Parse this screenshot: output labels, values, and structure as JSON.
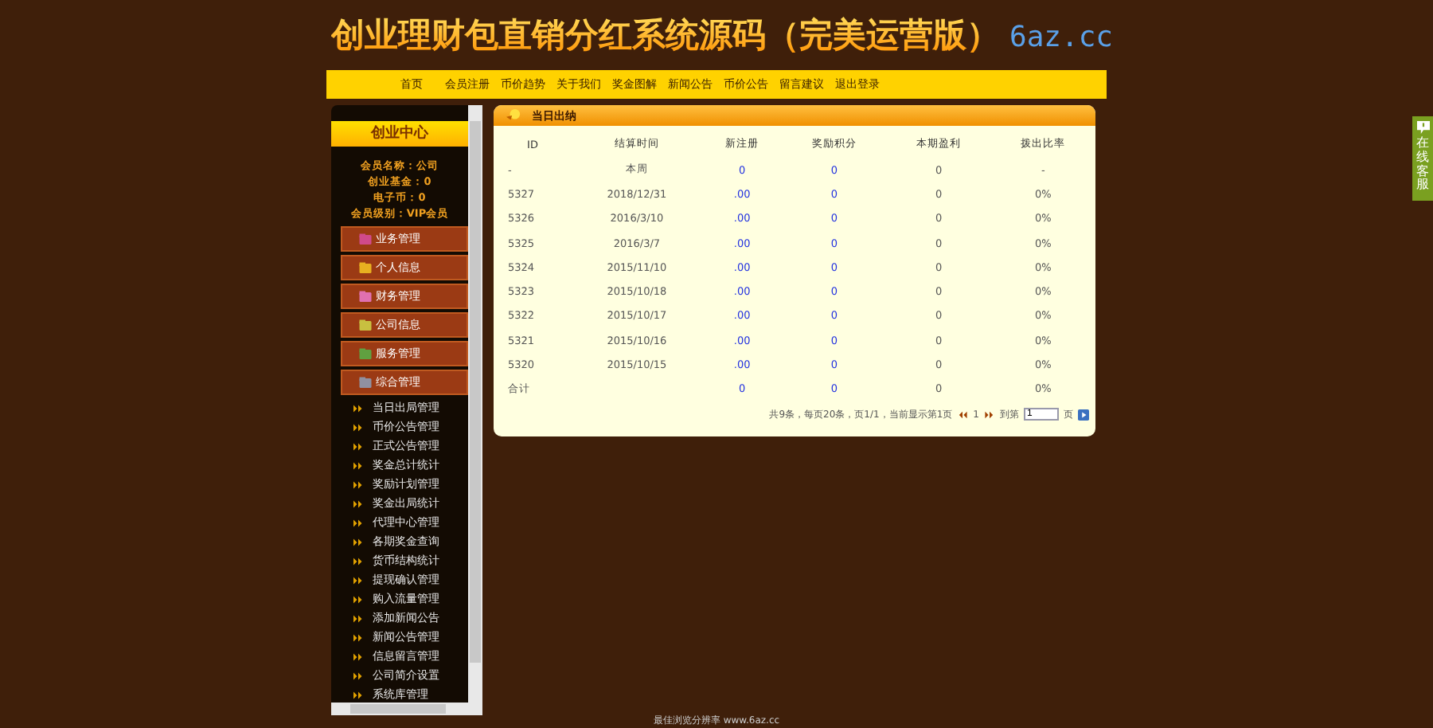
{
  "header": {
    "title": "创业理财包直销分红系统源码（完美运营版）",
    "domain": "6az.cc"
  },
  "nav": [
    "首页",
    "会员注册",
    "币价趋势",
    "关于我们",
    "奖金图解",
    "新闻公告",
    "币价公告",
    "留言建议",
    "退出登录"
  ],
  "sidebar": {
    "title": "创业中心",
    "info": [
      "会员名称：公司",
      "创业基金：0",
      "电子币：0",
      "会员级别：VIP会员"
    ],
    "menu": [
      {
        "label": "业务管理"
      },
      {
        "label": "个人信息"
      },
      {
        "label": "财务管理"
      },
      {
        "label": "公司信息"
      },
      {
        "label": "服务管理"
      },
      {
        "label": "综合管理"
      }
    ],
    "subitems": [
      "当日出局管理",
      "币价公告管理",
      "正式公告管理",
      "奖金总计统计",
      "奖励计划管理",
      "奖金出局统计",
      "代理中心管理",
      "各期奖金查询",
      "货币结构统计",
      "提现确认管理",
      "购入流量管理",
      "添加新闻公告",
      "新闻公告管理",
      "信息留言管理",
      "公司简介设置",
      "系统库管理"
    ]
  },
  "panel": {
    "title": "当日出纳",
    "columns": [
      "ID",
      "结算时间",
      "新注册",
      "奖励积分",
      "本期盈利",
      "拨出比率"
    ],
    "rows": [
      [
        "-",
        "本周",
        "0",
        "0",
        "0",
        "-"
      ],
      [
        "5327",
        "2018/12/31",
        ".00",
        "0",
        "0",
        "0%"
      ],
      [
        "5326",
        "2016/3/10",
        ".00",
        "0",
        "0",
        "0%"
      ],
      [
        "5325",
        "2016/3/7",
        ".00",
        "0",
        "0",
        "0%"
      ],
      [
        "5324",
        "2015/11/10",
        ".00",
        "0",
        "0",
        "0%"
      ],
      [
        "5323",
        "2015/10/18",
        ".00",
        "0",
        "0",
        "0%"
      ],
      [
        "5322",
        "2015/10/17",
        ".00",
        "0",
        "0",
        "0%"
      ],
      [
        "5321",
        "2015/10/16",
        ".00",
        "0",
        "0",
        "0%"
      ],
      [
        "5320",
        "2015/10/15",
        ".00",
        "0",
        "0",
        "0%"
      ],
      [
        "合计",
        "",
        "0",
        "0",
        "0",
        "0%"
      ]
    ],
    "pager": {
      "summary": "共9条，每页20条，页1/1，当前显示第1页",
      "page": "1",
      "goto_label": "到第",
      "page_input": "1",
      "page_suffix": "页"
    }
  },
  "footer": "最佳浏览分辨率 www.6az.cc",
  "float_service": "在线客服"
}
